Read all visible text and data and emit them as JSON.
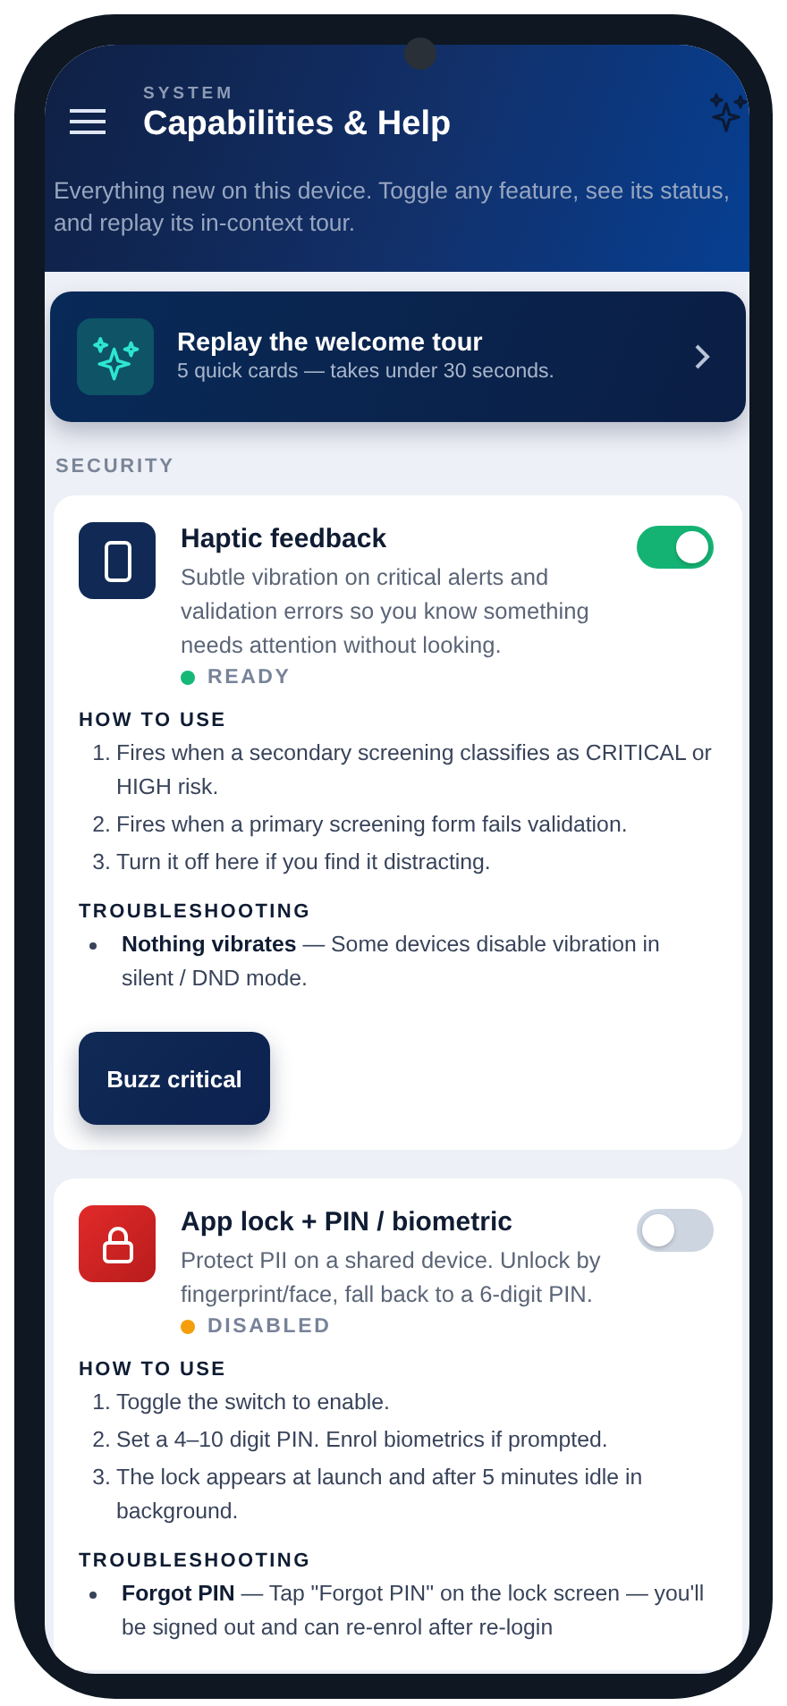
{
  "header": {
    "overline": "SYSTEM",
    "title": "Capabilities & Help",
    "description": "Everything new on this device. Toggle any feature, see its status, and replay its in-context tour."
  },
  "tour": {
    "title": "Replay the welcome tour",
    "subtitle": "5 quick cards — takes under 30 seconds."
  },
  "section_label": "SECURITY",
  "features": [
    {
      "kind": "phone",
      "title": "Haptic feedback",
      "description": "Subtle vibration on critical alerts and validation errors so you know something needs attention without looking.",
      "on": true,
      "status": {
        "label": "READY",
        "color": "#16b877"
      },
      "how_to_use": {
        "heading": "HOW TO USE",
        "steps": [
          {
            "number": "1.",
            "text": "Fires when a secondary screening classifies as CRITICAL or HIGH risk."
          },
          {
            "number": "2.",
            "text": "Fires when a primary screening form fails validation."
          },
          {
            "number": "3.",
            "text": "Turn it off here if you find it distracting."
          }
        ]
      },
      "troubleshooting": {
        "heading": "TROUBLESHOOTING",
        "items": [
          "**Nothing vibrates** — Some devices disable vibration in silent / DND mode."
        ]
      },
      "action": "Buzz critical"
    },
    {
      "kind": "lock",
      "title": "App lock + PIN / biometric",
      "description": "Protect PII on a shared device. Unlock by fingerprint/face, fall back to a 6-digit PIN.",
      "on": false,
      "status": {
        "label": "DISABLED",
        "color": "#f59e0b"
      },
      "how_to_use": {
        "heading": "HOW TO USE",
        "steps": [
          {
            "number": "1.",
            "text": "Toggle the switch to enable."
          },
          {
            "number": "2.",
            "text": "Set a 4–10 digit PIN. Enrol biometrics if prompted."
          },
          {
            "number": "3.",
            "text": "The lock appears at launch and after 5 minutes idle in background."
          }
        ]
      },
      "troubleshooting": {
        "heading": "TROUBLESHOOTING",
        "items": [
          "**Forgot PIN** — Tap \"Forgot PIN\" on the lock screen — you'll be signed out and can re-enrol after re-login"
        ]
      }
    }
  ]
}
